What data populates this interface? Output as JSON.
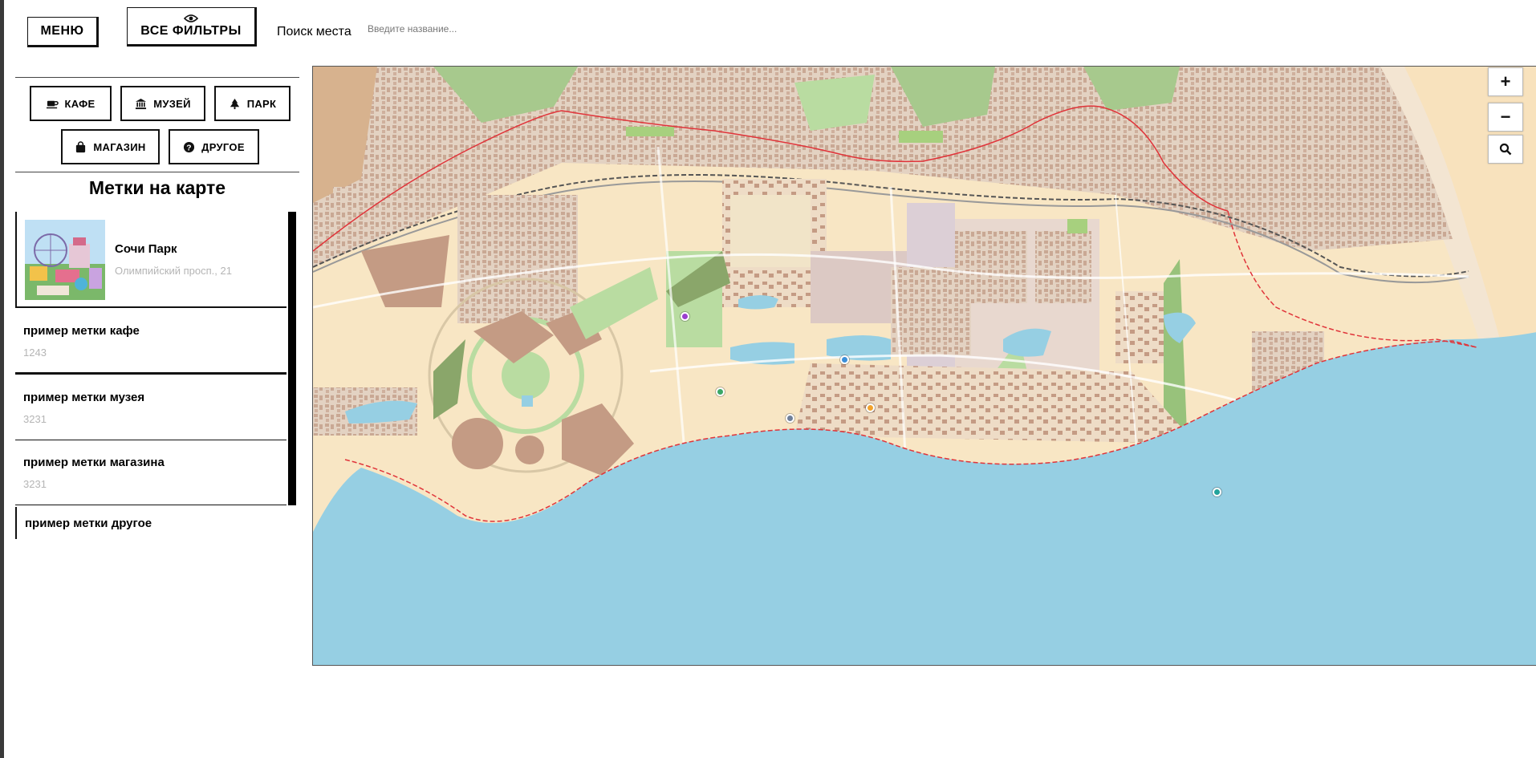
{
  "top_bar": {
    "menu_label": "МЕНЮ",
    "filters_label": "ВСЕ ФИЛЬТРЫ",
    "search_label": "Поиск места",
    "search_placeholder": "Введите название..."
  },
  "filters": [
    {
      "label": "КАФЕ",
      "icon": "coffee-icon"
    },
    {
      "label": "МУЗЕЙ",
      "icon": "museum-icon"
    },
    {
      "label": "ПАРК",
      "icon": "tree-icon"
    },
    {
      "label": "МАГАЗИН",
      "icon": "shopping-bag-icon"
    },
    {
      "label": "ДРУГОЕ",
      "icon": "question-icon"
    }
  ],
  "list": {
    "title": "Метки на карте",
    "items": [
      {
        "name": "Сочи Парк",
        "subtitle": "Олимпийский просп., 21",
        "has_thumbnail": true
      },
      {
        "name": "пример метки кафе",
        "subtitle": "1243"
      },
      {
        "name": "пример метки музея",
        "subtitle": "3231"
      },
      {
        "name": "пример метки магазина",
        "subtitle": "3231"
      },
      {
        "name": "пример метки другое",
        "subtitle": ""
      }
    ]
  },
  "map": {
    "zoom_in_label": "+",
    "zoom_out_label": "−",
    "colors": {
      "land": "#f8e6c4",
      "sea": "#96cfe3",
      "green": "#b9dca1",
      "buildings": "#c49b84",
      "border": "#e0343a"
    },
    "markers": [
      {
        "name": "park-marker",
        "color": "#9b3fcf"
      },
      {
        "name": "museum-marker",
        "color": "#3b8fd9"
      },
      {
        "name": "cafe-marker",
        "color": "#f2a22c"
      },
      {
        "name": "shop-marker",
        "color": "#3aa766"
      },
      {
        "name": "other-marker",
        "color": "#6f7f99"
      },
      {
        "name": "teal-marker",
        "color": "#22a39c"
      }
    ]
  }
}
